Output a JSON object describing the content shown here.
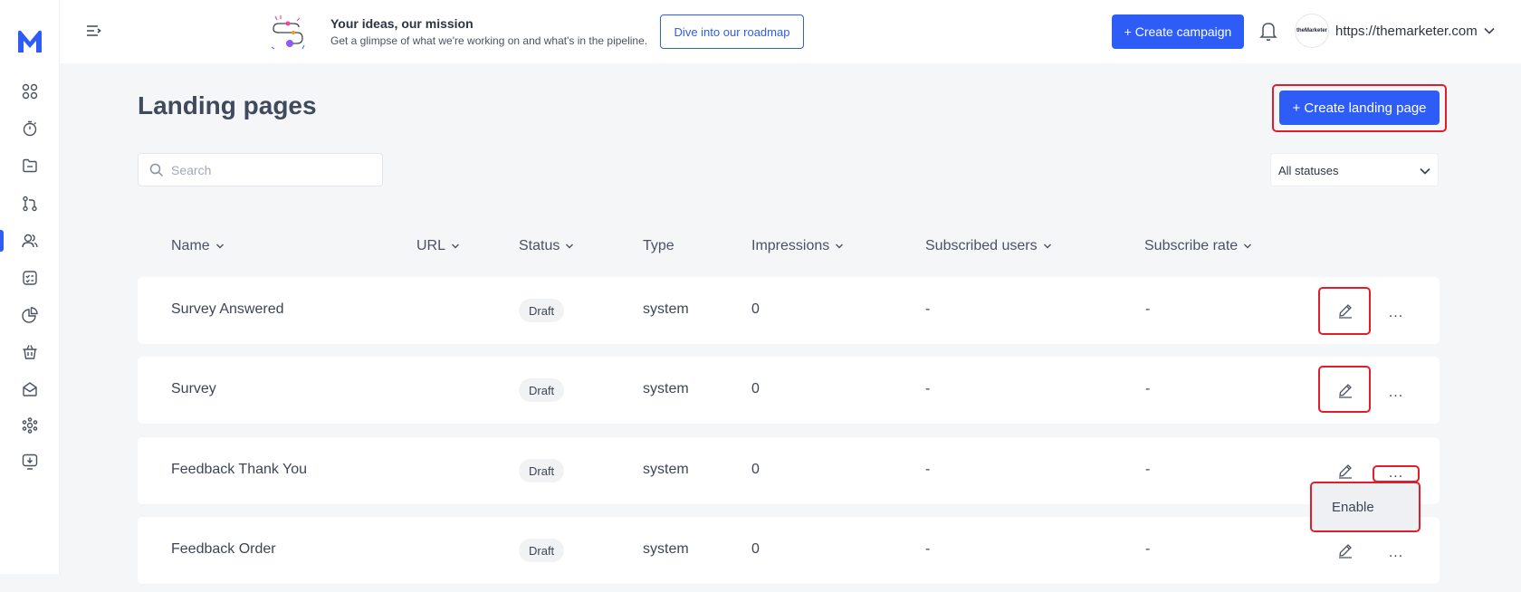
{
  "sidebar": {
    "logo": "M-logo-icon",
    "items": [
      {
        "icon": "grid-icon"
      },
      {
        "icon": "timer-icon"
      },
      {
        "icon": "folder-icon"
      },
      {
        "icon": "flow-icon"
      },
      {
        "icon": "users-icon",
        "active": true
      },
      {
        "icon": "checklist-icon"
      },
      {
        "icon": "pie-chart-icon"
      },
      {
        "icon": "basket-icon"
      },
      {
        "icon": "mail-icon"
      },
      {
        "icon": "network-icon"
      },
      {
        "icon": "download-icon"
      }
    ]
  },
  "header": {
    "promo_title": "Your ideas, our mission",
    "promo_subtitle": "Get a glimpse of what we're working on and what's in the pipeline.",
    "roadmap_button": "Dive into our roadmap",
    "create_campaign": "+ Create campaign",
    "account_logo_text": "theMarketer",
    "account_url": "https://themarketer.com"
  },
  "main": {
    "title": "Landing pages",
    "create_button": "+ Create landing page",
    "search_placeholder": "Search",
    "status_filter": "All statuses",
    "columns": {
      "name": "Name",
      "url": "URL",
      "status": "Status",
      "type": "Type",
      "impressions": "Impressions",
      "subscribed_users": "Subscribed users",
      "subscribe_rate": "Subscribe rate"
    },
    "rows": [
      {
        "name": "Survey Answered",
        "url": "",
        "status": "Draft",
        "type": "system",
        "impressions": "0",
        "subscribed_users": "-",
        "subscribe_rate": "-",
        "more": "..."
      },
      {
        "name": "Survey",
        "url": "",
        "status": "Draft",
        "type": "system",
        "impressions": "0",
        "subscribed_users": "-",
        "subscribe_rate": "-",
        "more": "..."
      },
      {
        "name": "Feedback Thank You",
        "url": "",
        "status": "Draft",
        "type": "system",
        "impressions": "0",
        "subscribed_users": "-",
        "subscribe_rate": "-",
        "more": "..."
      },
      {
        "name": "Feedback Order",
        "url": "",
        "status": "Draft",
        "type": "system",
        "impressions": "0",
        "subscribed_users": "-",
        "subscribe_rate": "-",
        "more": "..."
      }
    ],
    "row_menu": {
      "enable": "Enable"
    }
  },
  "colors": {
    "accent": "#2e5cf6",
    "highlight": "#e11d2a",
    "background": "#f5f6f8"
  }
}
